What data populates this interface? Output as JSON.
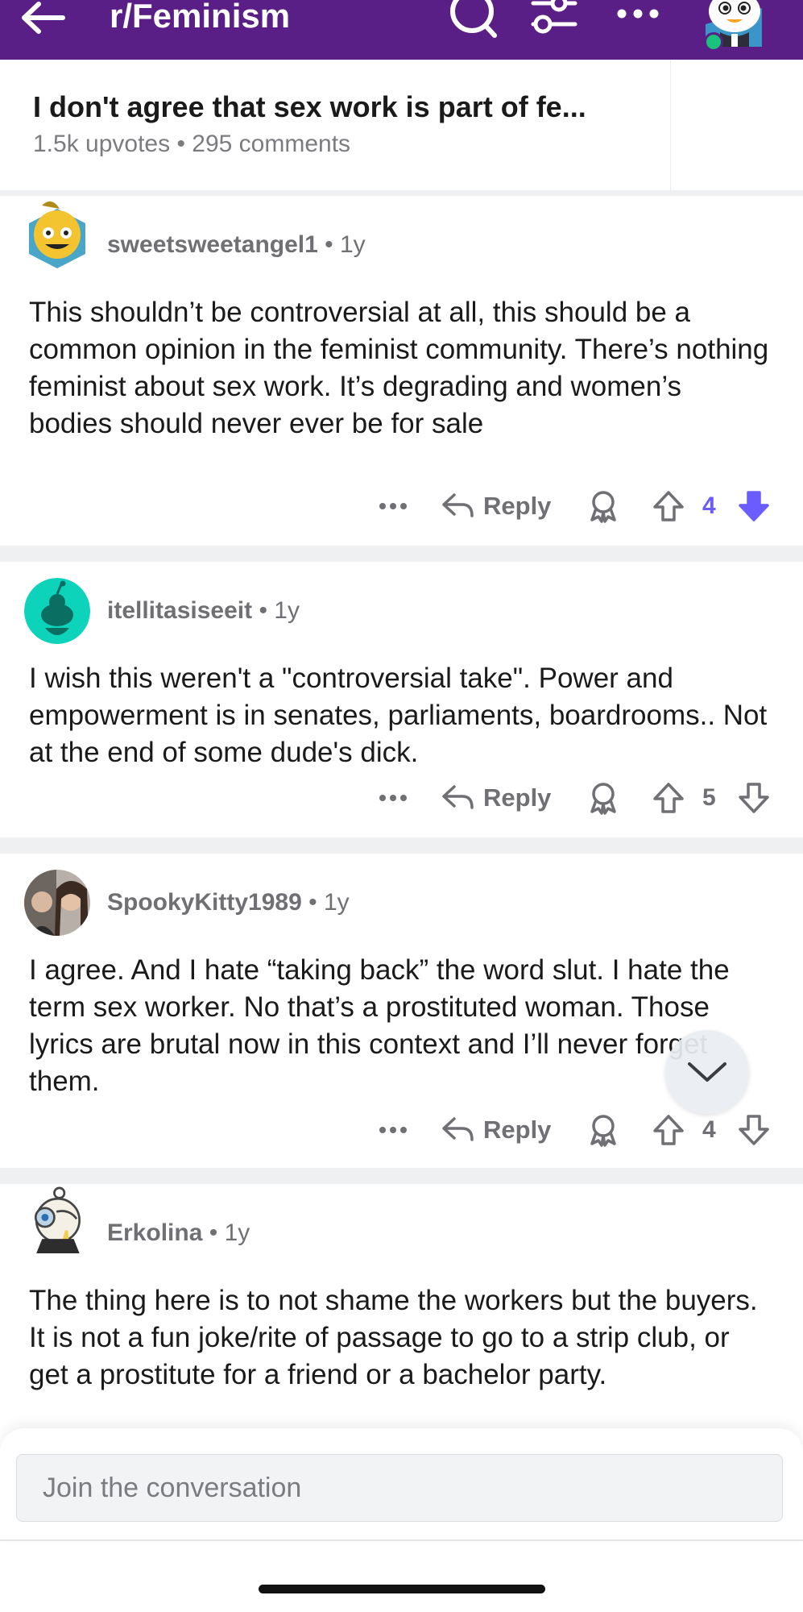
{
  "header": {
    "title": "r/Feminism",
    "background": "#5a1f86",
    "icons": [
      "back-arrow-icon",
      "search-icon",
      "filter-sliders-icon",
      "more-dots-icon",
      "user-avatar"
    ]
  },
  "post": {
    "title": "I don't agree that sex work is part of fe...",
    "meta": "1.5k upvotes • 295 comments"
  },
  "comments": [
    {
      "username": "sweetsweetangel1",
      "separator": "•",
      "age": "1y",
      "body": "This shouldn’t be controversial at all, this should be a common opinion in the feminist community. There’s nothing feminist about sex work. It’s degrading and women’s bodies should never ever be for sale",
      "reply_label": "Reply",
      "votes": "4",
      "vote_state": "downvoted"
    },
    {
      "username": "itellitasiseeit",
      "separator": "•",
      "age": "1y",
      "body": "I wish this weren't a \"controversial take\". Power and empowerment is in senates, parliaments, boardrooms.. Not at the end of some dude's dick.",
      "reply_label": "Reply",
      "votes": "5",
      "vote_state": "none"
    },
    {
      "username": "SpookyKitty1989",
      "separator": "•",
      "age": "1y",
      "body": "I agree.  And I hate “taking back” the word slut.  I hate the term sex worker.  No that’s a prostituted woman.  Those lyrics are brutal now in this context and I’ll never forget them.",
      "reply_label": "Reply",
      "votes": "4",
      "vote_state": "none"
    },
    {
      "username": "Erkolina",
      "separator": "•",
      "age": "1y",
      "body": "The thing here is to not shame the workers but the buyers. It is not a fun joke/rite of passage to go to a strip club, or get a prostitute for a friend or a bachelor party."
    }
  ],
  "composer": {
    "placeholder": "Join the conversation"
  },
  "colors": {
    "accent": "#6a5cff",
    "muted_text": "#6f6f74",
    "separator": "#eef0f2"
  }
}
